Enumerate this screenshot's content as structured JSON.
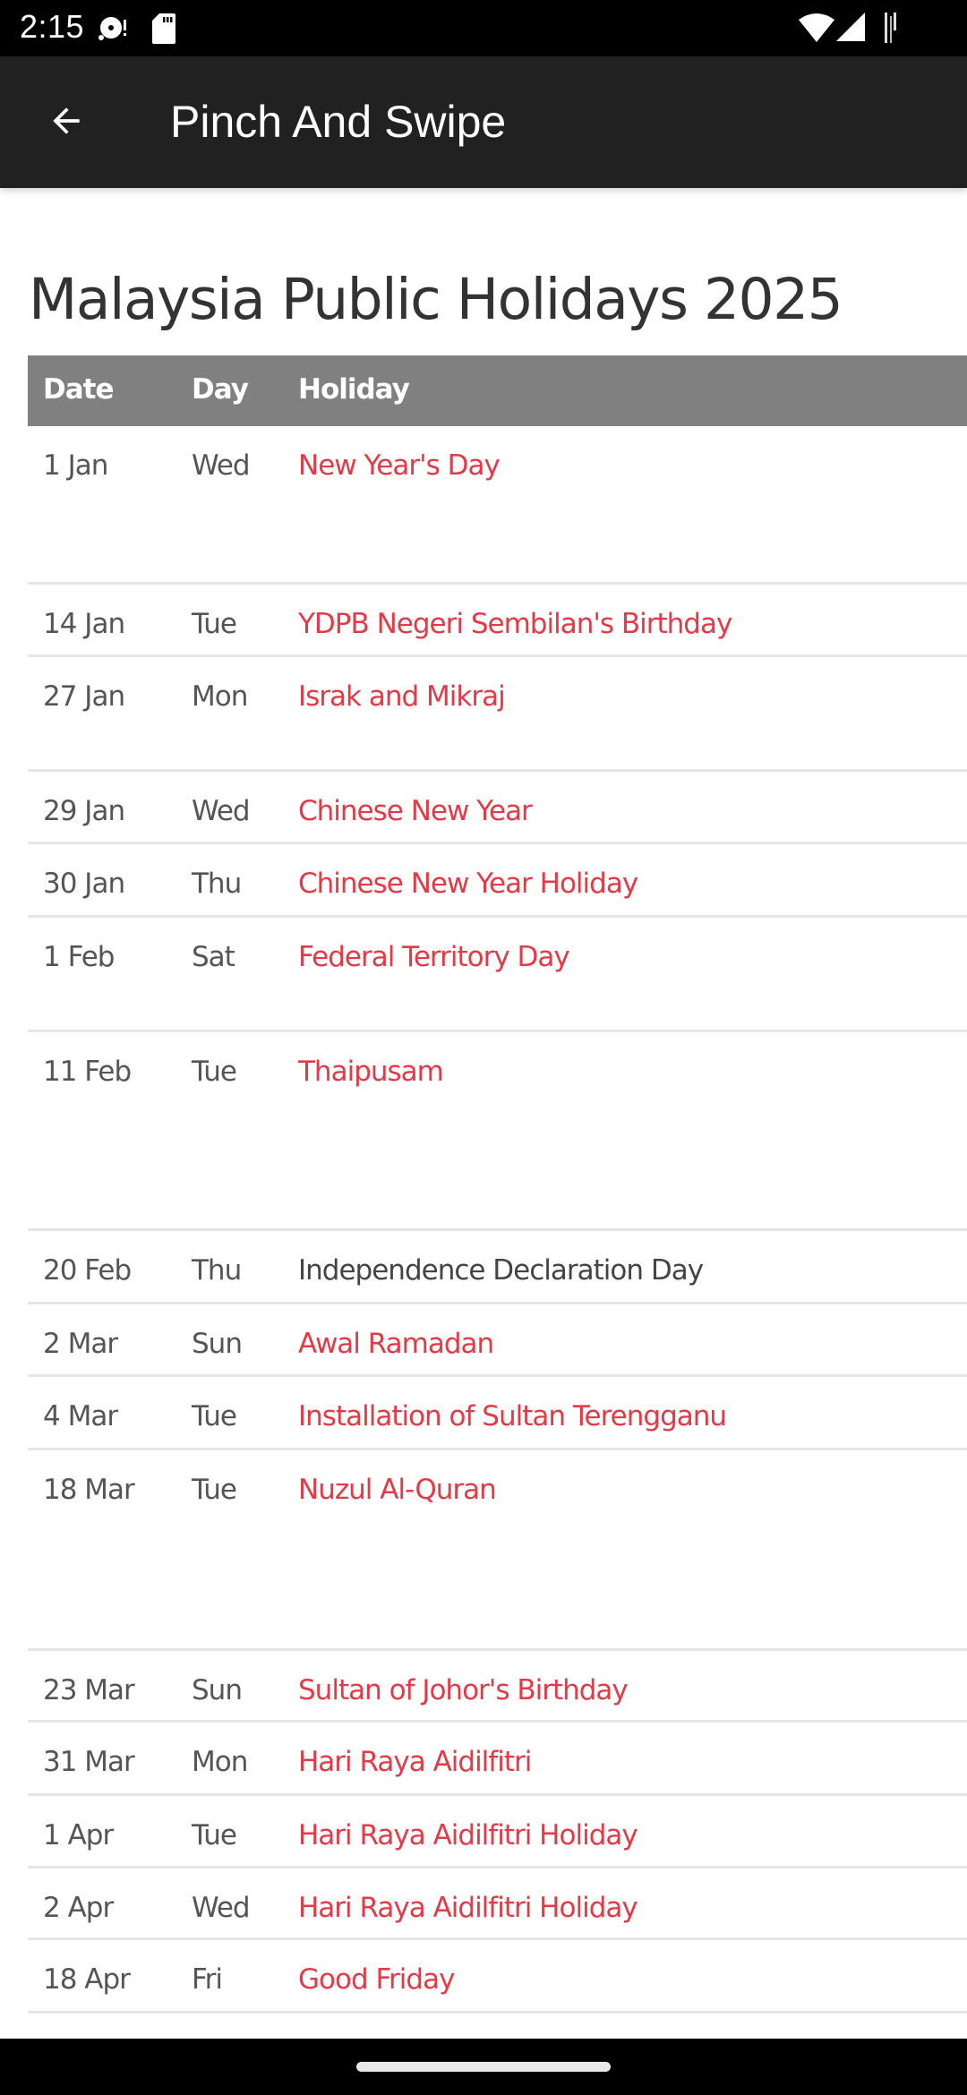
{
  "status_bar": {
    "time": "2:15",
    "left_icons": [
      "sync-alert-icon",
      "sd-card-icon"
    ],
    "right_icons": [
      "wifi-icon",
      "cell-signal-icon",
      "battery-icon"
    ]
  },
  "app_bar": {
    "back_icon": "arrow-back-icon",
    "title": "Pinch And Swipe"
  },
  "page": {
    "heading": "Malaysia Public Holidays 2025",
    "table": {
      "columns": [
        "Date",
        "Day",
        "Holiday"
      ],
      "rows": [
        {
          "date": "1 Jan",
          "day": "Wed",
          "holiday": "New Year's Day",
          "link": true
        },
        {
          "date": "14 Jan",
          "day": "Tue",
          "holiday": "YDPB Negeri Sembilan's Birthday",
          "link": true
        },
        {
          "date": "27 Jan",
          "day": "Mon",
          "holiday": "Israk and Mikraj",
          "link": true
        },
        {
          "date": "29 Jan",
          "day": "Wed",
          "holiday": "Chinese New Year",
          "link": true
        },
        {
          "date": "30 Jan",
          "day": "Thu",
          "holiday": "Chinese New Year Holiday",
          "link": true
        },
        {
          "date": "1 Feb",
          "day": "Sat",
          "holiday": "Federal Territory Day",
          "link": true
        },
        {
          "date": "11 Feb",
          "day": "Tue",
          "holiday": "Thaipusam",
          "link": true
        },
        {
          "date": "20 Feb",
          "day": "Thu",
          "holiday": "Independence Declaration Day",
          "link": false
        },
        {
          "date": "2 Mar",
          "day": "Sun",
          "holiday": "Awal Ramadan",
          "link": true
        },
        {
          "date": "4 Mar",
          "day": "Tue",
          "holiday": "Installation of Sultan Terengganu",
          "link": true
        },
        {
          "date": "18 Mar",
          "day": "Tue",
          "holiday": "Nuzul Al-Quran",
          "link": true
        },
        {
          "date": "23 Mar",
          "day": "Sun",
          "holiday": "Sultan of Johor's Birthday",
          "link": true
        },
        {
          "date": "31 Mar",
          "day": "Mon",
          "holiday": "Hari Raya Aidilfitri",
          "link": true
        },
        {
          "date": "1 Apr",
          "day": "Tue",
          "holiday": "Hari Raya Aidilfitri Holiday",
          "link": true
        },
        {
          "date": "2 Apr",
          "day": "Wed",
          "holiday": "Hari Raya Aidilfitri Holiday",
          "link": true
        },
        {
          "date": "18 Apr",
          "day": "Fri",
          "holiday": "Good Friday",
          "link": true
        }
      ]
    }
  },
  "colors": {
    "app_bar": "#212121",
    "table_header": "#808080",
    "holiday_link": "#e53945",
    "text": "#555555"
  },
  "nav_bar": {
    "home_indicator": "home-gesture-pill"
  }
}
